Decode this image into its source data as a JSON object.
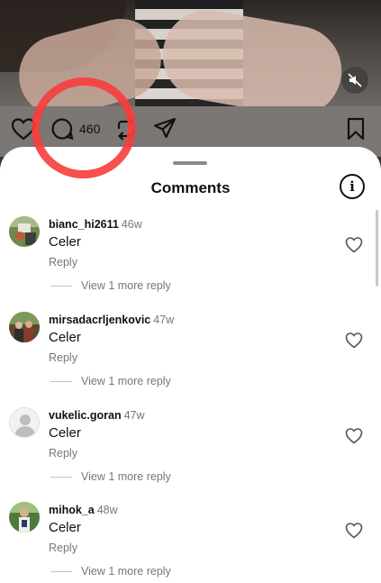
{
  "post": {
    "comment_count": "460"
  },
  "sheet": {
    "title": "Comments",
    "info_glyph": "i"
  },
  "comments": [
    {
      "user": "bianc_hi2611",
      "age": "46w",
      "text": "Celer",
      "reply_label": "Reply",
      "view_more_label": "View 1 more reply",
      "avatar": "avatar-photo"
    },
    {
      "user": "mirsadacrljenkovic",
      "age": "47w",
      "text": "Celer",
      "reply_label": "Reply",
      "view_more_label": "View 1 more reply",
      "avatar": "avatar-photo"
    },
    {
      "user": "vukelic.goran",
      "age": "47w",
      "text": "Celer",
      "reply_label": "Reply",
      "view_more_label": "View 1 more reply",
      "avatar": "default-avatar"
    },
    {
      "user": "mihok_a",
      "age": "48w",
      "text": "Celer",
      "reply_label": "Reply",
      "view_more_label": "View 1 more reply",
      "avatar": "avatar-photo"
    }
  ],
  "colors": {
    "annotation_circle": "#fa3c3c",
    "muted_text": "#777777",
    "sheet_bg": "#ffffff"
  },
  "icons": [
    "heart-icon",
    "comment-icon",
    "repost-icon",
    "share-icon",
    "bookmark-icon",
    "mute-icon",
    "info-icon"
  ]
}
